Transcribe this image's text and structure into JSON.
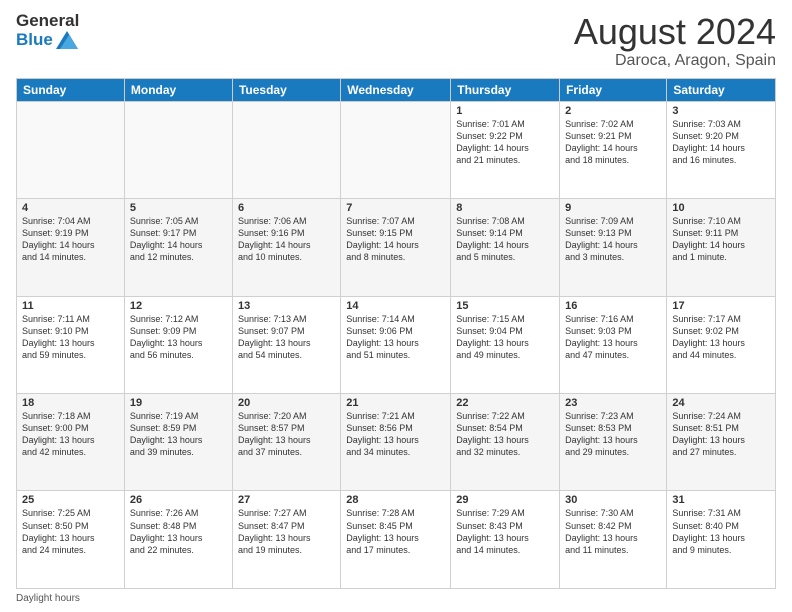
{
  "logo": {
    "general": "General",
    "blue": "Blue"
  },
  "title": "August 2024",
  "location": "Daroca, Aragon, Spain",
  "weekdays": [
    "Sunday",
    "Monday",
    "Tuesday",
    "Wednesday",
    "Thursday",
    "Friday",
    "Saturday"
  ],
  "footer": "Daylight hours",
  "weeks": [
    [
      {
        "day": "",
        "info": ""
      },
      {
        "day": "",
        "info": ""
      },
      {
        "day": "",
        "info": ""
      },
      {
        "day": "",
        "info": ""
      },
      {
        "day": "1",
        "info": "Sunrise: 7:01 AM\nSunset: 9:22 PM\nDaylight: 14 hours\nand 21 minutes."
      },
      {
        "day": "2",
        "info": "Sunrise: 7:02 AM\nSunset: 9:21 PM\nDaylight: 14 hours\nand 18 minutes."
      },
      {
        "day": "3",
        "info": "Sunrise: 7:03 AM\nSunset: 9:20 PM\nDaylight: 14 hours\nand 16 minutes."
      }
    ],
    [
      {
        "day": "4",
        "info": "Sunrise: 7:04 AM\nSunset: 9:19 PM\nDaylight: 14 hours\nand 14 minutes."
      },
      {
        "day": "5",
        "info": "Sunrise: 7:05 AM\nSunset: 9:17 PM\nDaylight: 14 hours\nand 12 minutes."
      },
      {
        "day": "6",
        "info": "Sunrise: 7:06 AM\nSunset: 9:16 PM\nDaylight: 14 hours\nand 10 minutes."
      },
      {
        "day": "7",
        "info": "Sunrise: 7:07 AM\nSunset: 9:15 PM\nDaylight: 14 hours\nand 8 minutes."
      },
      {
        "day": "8",
        "info": "Sunrise: 7:08 AM\nSunset: 9:14 PM\nDaylight: 14 hours\nand 5 minutes."
      },
      {
        "day": "9",
        "info": "Sunrise: 7:09 AM\nSunset: 9:13 PM\nDaylight: 14 hours\nand 3 minutes."
      },
      {
        "day": "10",
        "info": "Sunrise: 7:10 AM\nSunset: 9:11 PM\nDaylight: 14 hours\nand 1 minute."
      }
    ],
    [
      {
        "day": "11",
        "info": "Sunrise: 7:11 AM\nSunset: 9:10 PM\nDaylight: 13 hours\nand 59 minutes."
      },
      {
        "day": "12",
        "info": "Sunrise: 7:12 AM\nSunset: 9:09 PM\nDaylight: 13 hours\nand 56 minutes."
      },
      {
        "day": "13",
        "info": "Sunrise: 7:13 AM\nSunset: 9:07 PM\nDaylight: 13 hours\nand 54 minutes."
      },
      {
        "day": "14",
        "info": "Sunrise: 7:14 AM\nSunset: 9:06 PM\nDaylight: 13 hours\nand 51 minutes."
      },
      {
        "day": "15",
        "info": "Sunrise: 7:15 AM\nSunset: 9:04 PM\nDaylight: 13 hours\nand 49 minutes."
      },
      {
        "day": "16",
        "info": "Sunrise: 7:16 AM\nSunset: 9:03 PM\nDaylight: 13 hours\nand 47 minutes."
      },
      {
        "day": "17",
        "info": "Sunrise: 7:17 AM\nSunset: 9:02 PM\nDaylight: 13 hours\nand 44 minutes."
      }
    ],
    [
      {
        "day": "18",
        "info": "Sunrise: 7:18 AM\nSunset: 9:00 PM\nDaylight: 13 hours\nand 42 minutes."
      },
      {
        "day": "19",
        "info": "Sunrise: 7:19 AM\nSunset: 8:59 PM\nDaylight: 13 hours\nand 39 minutes."
      },
      {
        "day": "20",
        "info": "Sunrise: 7:20 AM\nSunset: 8:57 PM\nDaylight: 13 hours\nand 37 minutes."
      },
      {
        "day": "21",
        "info": "Sunrise: 7:21 AM\nSunset: 8:56 PM\nDaylight: 13 hours\nand 34 minutes."
      },
      {
        "day": "22",
        "info": "Sunrise: 7:22 AM\nSunset: 8:54 PM\nDaylight: 13 hours\nand 32 minutes."
      },
      {
        "day": "23",
        "info": "Sunrise: 7:23 AM\nSunset: 8:53 PM\nDaylight: 13 hours\nand 29 minutes."
      },
      {
        "day": "24",
        "info": "Sunrise: 7:24 AM\nSunset: 8:51 PM\nDaylight: 13 hours\nand 27 minutes."
      }
    ],
    [
      {
        "day": "25",
        "info": "Sunrise: 7:25 AM\nSunset: 8:50 PM\nDaylight: 13 hours\nand 24 minutes."
      },
      {
        "day": "26",
        "info": "Sunrise: 7:26 AM\nSunset: 8:48 PM\nDaylight: 13 hours\nand 22 minutes."
      },
      {
        "day": "27",
        "info": "Sunrise: 7:27 AM\nSunset: 8:47 PM\nDaylight: 13 hours\nand 19 minutes."
      },
      {
        "day": "28",
        "info": "Sunrise: 7:28 AM\nSunset: 8:45 PM\nDaylight: 13 hours\nand 17 minutes."
      },
      {
        "day": "29",
        "info": "Sunrise: 7:29 AM\nSunset: 8:43 PM\nDaylight: 13 hours\nand 14 minutes."
      },
      {
        "day": "30",
        "info": "Sunrise: 7:30 AM\nSunset: 8:42 PM\nDaylight: 13 hours\nand 11 minutes."
      },
      {
        "day": "31",
        "info": "Sunrise: 7:31 AM\nSunset: 8:40 PM\nDaylight: 13 hours\nand 9 minutes."
      }
    ]
  ]
}
